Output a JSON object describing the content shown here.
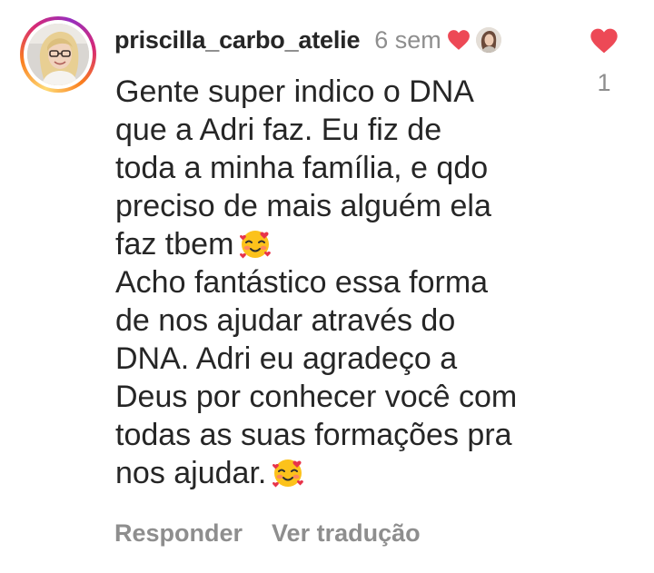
{
  "comment": {
    "username": "priscilla_carbo_atelie",
    "time_ago": "6 sem",
    "lines": [
      "Gente super indico o DNA",
      "que a Adri faz. Eu fiz de",
      "toda a minha família, e qdo",
      "preciso de mais alguém ela",
      "faz tbem",
      "Acho fantástico essa forma",
      "de nos ajudar através do",
      "DNA. Adri eu agradeço a",
      "Deus por conhecer você com",
      "todas as suas formações pra",
      "nos ajudar."
    ],
    "emoji": "smiling-face-with-hearts-icon",
    "like_count": "1",
    "liked_by_creator": true
  },
  "actions": {
    "reply_label": "Responder",
    "translate_label": "Ver tradução"
  },
  "colors": {
    "text": "#262626",
    "secondary": "#8e8e8e",
    "like_red": "#ed4956"
  }
}
